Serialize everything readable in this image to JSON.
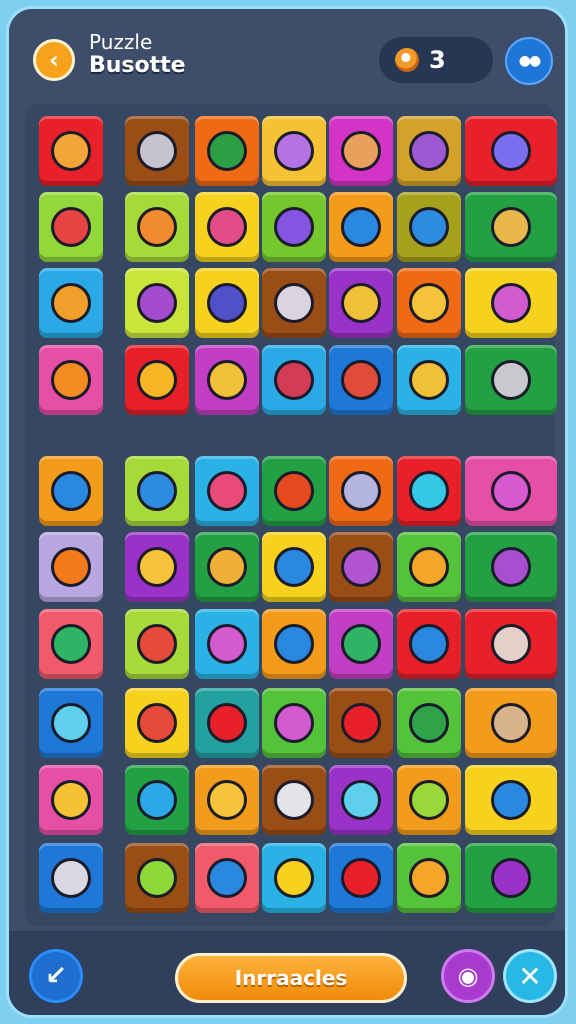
{
  "header": {
    "title_top": "Puzzle",
    "title_main": "Busotte",
    "back_icon": "chevron-left-icon",
    "coin_icon": "coin-icon",
    "coins": "3",
    "menu_icon": "dots-icon"
  },
  "footer": {
    "action_label": "Inrraacles",
    "left_icon": "arrow-down-left-icon",
    "camera_icon": "camera-icon",
    "close_icon": "close-icon"
  },
  "colors": {
    "background": "#3d4d6a",
    "accent": "#f7a21d",
    "frame": "#9be0f8"
  },
  "tiles": [
    {
      "color": "#e8202a",
      "glyph": "#f3a53a",
      "wide": false
    },
    {
      "color": "#9a4d15",
      "glyph": "#c7c2cf",
      "wide": false
    },
    {
      "color": "#f06a16",
      "glyph": "#2e9e46",
      "wide": false
    },
    {
      "color": "#f4c233",
      "glyph": "#b473e3",
      "wide": false
    },
    {
      "color": "#d434c6",
      "glyph": "#e8a15c",
      "wide": false
    },
    {
      "color": "#d4a22a",
      "glyph": "#9c59d1",
      "wide": false
    },
    {
      "color": "#e8202a",
      "glyph": "#7b6ff0",
      "wide": true
    },
    {
      "color": "#93d83a",
      "glyph": "#e84343",
      "wide": false
    },
    {
      "color": "#a6da39",
      "glyph": "#f28a2e",
      "wide": false
    },
    {
      "color": "#f6d21e",
      "glyph": "#e14c89",
      "wide": false
    },
    {
      "color": "#76c62e",
      "glyph": "#8455e0",
      "wide": false
    },
    {
      "color": "#f39b1a",
      "glyph": "#2a88e0",
      "wide": false
    },
    {
      "color": "#a6a11d",
      "glyph": "#2e8ce0",
      "wide": false
    },
    {
      "color": "#23a043",
      "glyph": "#e8b84a",
      "wide": true
    },
    {
      "color": "#2aa9e6",
      "glyph": "#f0a02a",
      "wide": false
    },
    {
      "color": "#c8e63a",
      "glyph": "#a44bd0",
      "wide": false
    },
    {
      "color": "#f6d21e",
      "glyph": "#5050c8",
      "wide": false
    },
    {
      "color": "#9a4d15",
      "glyph": "#d9d4df",
      "wide": false
    },
    {
      "color": "#9b32c8",
      "glyph": "#f0c038",
      "wide": false
    },
    {
      "color": "#f06a16",
      "glyph": "#f5c43a",
      "wide": false
    },
    {
      "color": "#f6d21e",
      "glyph": "#d45ad0",
      "wide": true
    },
    {
      "color": "#e64fa6",
      "glyph": "#f38a22",
      "wide": false
    },
    {
      "color": "#e8202a",
      "glyph": "#f7b625",
      "wide": false
    },
    {
      "color": "#c23ec4",
      "glyph": "#f0c038",
      "wide": false
    },
    {
      "color": "#2aa9e6",
      "glyph": "#d23c55",
      "wide": false
    },
    {
      "color": "#1e78d8",
      "glyph": "#e14b3a",
      "wide": false
    },
    {
      "color": "#2ab2e6",
      "glyph": "#f0c038",
      "wide": false
    },
    {
      "color": "#23a043",
      "glyph": "#c8c8cf",
      "wide": true
    },
    {
      "color": "#f39b1a",
      "glyph": "#2a88e0",
      "wide": false
    },
    {
      "color": "#a6da39",
      "glyph": "#2e8ce0",
      "wide": false
    },
    {
      "color": "#2ab2e6",
      "glyph": "#e84a7a",
      "wide": false
    },
    {
      "color": "#23a043",
      "glyph": "#e84a20",
      "wide": false
    },
    {
      "color": "#f06a16",
      "glyph": "#b4b4e0",
      "wide": false
    },
    {
      "color": "#e8202a",
      "glyph": "#34c7e6",
      "wide": false
    },
    {
      "color": "#e64fa6",
      "glyph": "#d75ad0",
      "wide": true
    },
    {
      "color": "#b8a6e0",
      "glyph": "#f27a1a",
      "wide": false
    },
    {
      "color": "#9b32c8",
      "glyph": "#f5c43a",
      "wide": false
    },
    {
      "color": "#23a043",
      "glyph": "#f0b038",
      "wide": false
    },
    {
      "color": "#f6d21e",
      "glyph": "#2a88e0",
      "wide": false
    },
    {
      "color": "#9a4d15",
      "glyph": "#b054d4",
      "wide": false
    },
    {
      "color": "#54c23a",
      "glyph": "#f4a62a",
      "wide": false
    },
    {
      "color": "#23a043",
      "glyph": "#a84fd0",
      "wide": true
    },
    {
      "color": "#f05a6a",
      "glyph": "#2fb466",
      "wide": false
    },
    {
      "color": "#a6da39",
      "glyph": "#e84a3a",
      "wide": false
    },
    {
      "color": "#2ab2e6",
      "glyph": "#d45ad0",
      "wide": false
    },
    {
      "color": "#f39b1a",
      "glyph": "#2a88e0",
      "wide": false
    },
    {
      "color": "#c23ec4",
      "glyph": "#2fb466",
      "wide": false
    },
    {
      "color": "#e8202a",
      "glyph": "#2a88e0",
      "wide": false
    },
    {
      "color": "#e8202a",
      "glyph": "#e3d0c8",
      "wide": true
    },
    {
      "color": "#1e78d8",
      "glyph": "#5ed0ee",
      "wide": false
    },
    {
      "color": "#f6d21e",
      "glyph": "#e84a3a",
      "wide": false
    },
    {
      "color": "#23a0a0",
      "glyph": "#e8202a",
      "wide": false
    },
    {
      "color": "#54c23a",
      "glyph": "#d45ad0",
      "wide": false
    },
    {
      "color": "#9a4d15",
      "glyph": "#e8202a",
      "wide": false
    },
    {
      "color": "#54c23a",
      "glyph": "#2fa34a",
      "wide": false
    },
    {
      "color": "#f39b1a",
      "glyph": "#d9b48a",
      "wide": true
    },
    {
      "color": "#e64fa6",
      "glyph": "#f4c233",
      "wide": false
    },
    {
      "color": "#23a043",
      "glyph": "#2aa9e6",
      "wide": false
    },
    {
      "color": "#f39b1a",
      "glyph": "#f5c43a",
      "wide": false
    },
    {
      "color": "#9a4d15",
      "glyph": "#e3e3e8",
      "wide": false
    },
    {
      "color": "#9b32c8",
      "glyph": "#5ed0ee",
      "wide": false
    },
    {
      "color": "#f39b1a",
      "glyph": "#9ad83a",
      "wide": false
    },
    {
      "color": "#f6d21e",
      "glyph": "#2a88e0",
      "wide": true
    },
    {
      "color": "#1e78d8",
      "glyph": "#d8d8e0",
      "wide": false
    },
    {
      "color": "#9a4d15",
      "glyph": "#8ed83a",
      "wide": false
    },
    {
      "color": "#f05a6a",
      "glyph": "#2a88e0",
      "wide": false
    },
    {
      "color": "#2ab2e6",
      "glyph": "#f6d21e",
      "wide": false
    },
    {
      "color": "#1e78d8",
      "glyph": "#e8202a",
      "wide": false
    },
    {
      "color": "#54c23a",
      "glyph": "#f4a62a",
      "wide": false
    },
    {
      "color": "#23a043",
      "glyph": "#9b32c8",
      "wide": true
    }
  ]
}
